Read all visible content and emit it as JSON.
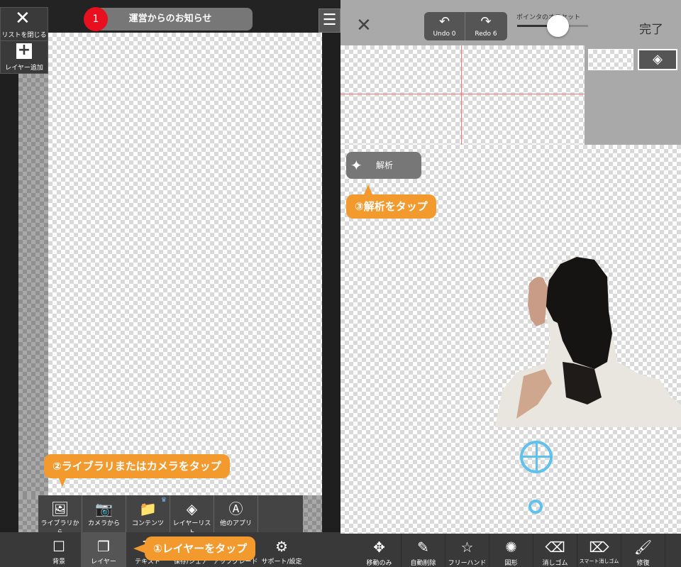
{
  "left_pane": {
    "notice_badge": "1",
    "notice_title": "運営からのお知らせ",
    "close_list_label": "リストを閉じる",
    "add_layer_label": "レイヤー追加",
    "add_menu": [
      {
        "label": "ライブラリから",
        "icon": "image-icon"
      },
      {
        "label": "カメラから",
        "icon": "camera-icon"
      },
      {
        "label": "コンテンツ",
        "icon": "folder-icon"
      },
      {
        "label": "レイヤーリスト",
        "icon": "layers-icon"
      },
      {
        "label": "他のアプリ",
        "icon": "app-store-icon"
      }
    ],
    "toolbar": [
      {
        "label": "背景",
        "icon": "square-icon"
      },
      {
        "label": "レイヤー",
        "icon": "layer-icon"
      },
      {
        "label": "テキスト",
        "icon": "text-icon"
      },
      {
        "label": "保存/シェア",
        "icon": "share-icon"
      },
      {
        "label": "アップグレード",
        "icon": "upgrade-icon"
      },
      {
        "label": "サポート/設定",
        "icon": "gear-icon"
      }
    ],
    "callout_1": "①レイヤーをタップ",
    "callout_2": "②ライブラリまたはカメラをタップ"
  },
  "right_pane": {
    "undo_label": "Undo 0",
    "redo_label": "Redo 6",
    "offset_label": "ポインタのオフセット",
    "done_label": "完了",
    "analyze_label": "解析",
    "callout_3": "③解析をタップ",
    "toolbar": [
      {
        "label": "移動のみ",
        "icon": "move-icon"
      },
      {
        "label": "自動削除",
        "icon": "eyedropper-icon"
      },
      {
        "label": "フリーハンド",
        "icon": "star-outline-icon"
      },
      {
        "label": "図形",
        "icon": "shape-icon"
      },
      {
        "label": "消しゴム",
        "icon": "eraser-icon"
      },
      {
        "label": "スマート消しゴム",
        "icon": "smart-eraser-icon"
      },
      {
        "label": "修復",
        "icon": "brush-icon"
      }
    ]
  },
  "colors": {
    "accent_orange": "#f29a2e",
    "badge_red": "#e8101e",
    "pointer_blue": "#5fc2ec"
  }
}
